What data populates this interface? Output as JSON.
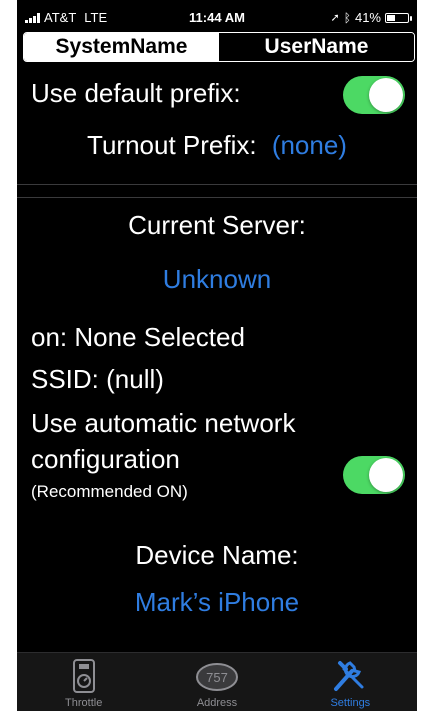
{
  "status_bar": {
    "carrier": "AT&T",
    "network": "LTE",
    "time": "11:44 AM",
    "battery": "41%",
    "battery_level": 0.41
  },
  "segmented": {
    "options": [
      "SystemName",
      "UserName"
    ],
    "selected": "SystemName"
  },
  "settings": {
    "default_prefix_label": "Use default prefix:",
    "default_prefix_on": true,
    "turnout_prefix_label": "Turnout Prefix:",
    "turnout_prefix_value": "(none)",
    "current_server_label": "Current Server:",
    "current_server_value": "Unknown",
    "on_label": "on: None Selected",
    "ssid_label": "SSID: (null)",
    "auto_network_line1": "Use automatic network",
    "auto_network_line2": "configuration",
    "auto_network_hint": "(Recommended ON)",
    "auto_network_on": true,
    "device_name_label": "Device Name:",
    "device_name_value": "Mark’s iPhone"
  },
  "tab_bar": {
    "tabs": [
      {
        "label": "Throttle",
        "icon": "throttle-icon",
        "active": false
      },
      {
        "label": "Address",
        "icon": "address-757-icon",
        "badge": "757",
        "active": false
      },
      {
        "label": "Settings",
        "icon": "wrench-screwdriver-icon",
        "active": true
      }
    ]
  },
  "colors": {
    "accent": "#2f7de1",
    "toggle_on": "#4cd964",
    "background": "#000000"
  }
}
